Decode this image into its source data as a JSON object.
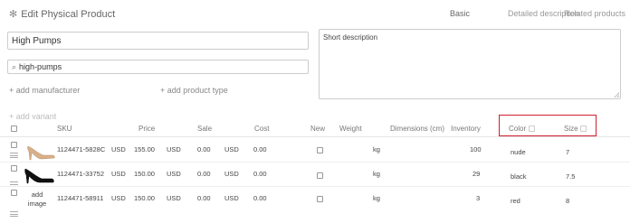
{
  "header": {
    "title": "Edit Physical Product",
    "tabs": [
      "Basic",
      "Detailed description",
      "Related products"
    ]
  },
  "form": {
    "name_value": "High Pumps",
    "slug_value": "high-pumps",
    "short_description_placeholder": "Short description",
    "add_manufacturer": "+ add manufacturer",
    "add_product_type": "+ add product type",
    "add_variant": "+ add variant"
  },
  "table": {
    "columns": {
      "sku": "SKU",
      "price": "Price",
      "sale": "Sale",
      "cost": "Cost",
      "new": "New",
      "weight": "Weight",
      "dimensions": "Dimensions (cm)",
      "inventory": "Inventory",
      "color": "Color",
      "size": "Size"
    },
    "add_image_label": "add image",
    "rows": [
      {
        "image": "nude-pump",
        "sku": "1124471-5828C",
        "currency1": "USD",
        "price": "155.00",
        "currency2": "USD",
        "sale": "0.00",
        "currency3": "USD",
        "cost": "0.00",
        "weight_unit": "kg",
        "inventory": "100",
        "color": "nude",
        "size": "7"
      },
      {
        "image": "black-pump",
        "sku": "1124471-33752",
        "currency1": "USD",
        "price": "150.00",
        "currency2": "USD",
        "sale": "0.00",
        "currency3": "USD",
        "cost": "0.00",
        "weight_unit": "kg",
        "inventory": "29",
        "color": "black",
        "size": "7.5"
      },
      {
        "image": "add-image",
        "sku": "1124471-58911",
        "currency1": "USD",
        "price": "150.00",
        "currency2": "USD",
        "sale": "0.00",
        "currency3": "USD",
        "cost": "0.00",
        "weight_unit": "kg",
        "inventory": "3",
        "color": "red",
        "size": "8"
      }
    ]
  },
  "colors": {
    "highlight": "#d01f2e",
    "border": "#cccccc"
  }
}
